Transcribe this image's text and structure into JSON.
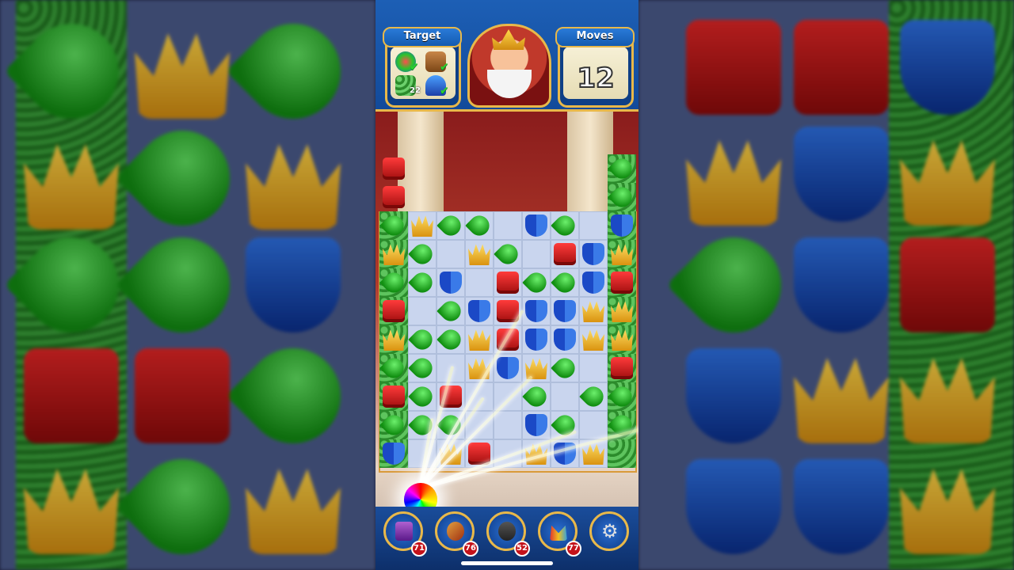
{
  "hud": {
    "target_label": "Target",
    "moves_label": "Moves",
    "moves_value": "12",
    "target_items": [
      {
        "icon": "potion-icon",
        "done": true
      },
      {
        "icon": "crate-icon",
        "done": true
      },
      {
        "icon": "grass-tile-icon",
        "count": "22"
      },
      {
        "icon": "helmet-icon",
        "done": true
      }
    ]
  },
  "boosters": [
    {
      "icon": "hammer-booster-icon",
      "count": "71"
    },
    {
      "icon": "bow-arrow-booster-icon",
      "count": "76"
    },
    {
      "icon": "cannon-booster-icon",
      "count": "52"
    },
    {
      "icon": "jester-hat-booster-icon",
      "count": "77"
    },
    {
      "icon": "settings-gear-icon"
    }
  ],
  "colors": {
    "topbar": "#1d5fb5",
    "frame_gold": "#e8b84a",
    "red_gem": "#e02525",
    "blue_gem": "#1b49c6",
    "green_gem": "#1fb01f",
    "gold_gem": "#f5b820"
  }
}
